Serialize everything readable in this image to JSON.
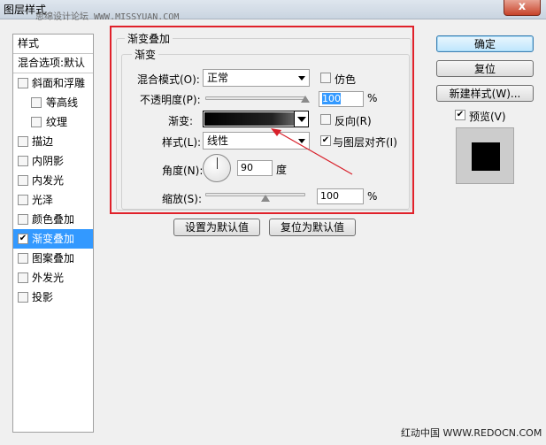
{
  "window": {
    "title": "图层样式",
    "watermark_top": "思绵设计论坛 WWW.MISSYUAN.COM",
    "close_label": "x"
  },
  "style_list": {
    "header": "样式",
    "blend_options": "混合选项:默认",
    "items": [
      {
        "label": "斜面和浮雕",
        "checked": false
      },
      {
        "label": "等高线",
        "checked": false,
        "sub": true
      },
      {
        "label": "纹理",
        "checked": false,
        "sub": true
      },
      {
        "label": "描边",
        "checked": false
      },
      {
        "label": "内阴影",
        "checked": false
      },
      {
        "label": "内发光",
        "checked": false
      },
      {
        "label": "光泽",
        "checked": false
      },
      {
        "label": "颜色叠加",
        "checked": false
      },
      {
        "label": "渐变叠加",
        "checked": true,
        "selected": true
      },
      {
        "label": "图案叠加",
        "checked": false
      },
      {
        "label": "外发光",
        "checked": false
      },
      {
        "label": "投影",
        "checked": false
      }
    ]
  },
  "panel": {
    "section_title": "渐变叠加",
    "group_title": "渐变",
    "blend_mode_label": "混合模式(O):",
    "blend_mode_value": "正常",
    "dither_label": "仿色",
    "dither_checked": false,
    "opacity_label": "不透明度(P):",
    "opacity_value": "100",
    "opacity_unit": "%",
    "opacity_level": 1.0,
    "gradient_label": "渐变:",
    "reverse_label": "反向(R)",
    "reverse_checked": false,
    "style_label": "样式(L):",
    "style_value": "线性",
    "align_label": "与图层对齐(I)",
    "align_checked": true,
    "angle_label": "角度(N):",
    "angle_value": "90",
    "angle_unit": "度",
    "scale_label": "缩放(S):",
    "scale_value": "100",
    "scale_unit": "%",
    "scale_level": 0.6,
    "make_default_label": "设置为默认值",
    "reset_default_label": "复位为默认值"
  },
  "right": {
    "ok_label": "确定",
    "reset_label": "复位",
    "new_style_label": "新建样式(W)...",
    "preview_label": "预览(V)",
    "preview_checked": true
  },
  "watermark_bottom": "红动中国 WWW.REDOCN.COM",
  "colors": {
    "highlight_box": "#e0212a",
    "selection": "#3399ff"
  }
}
